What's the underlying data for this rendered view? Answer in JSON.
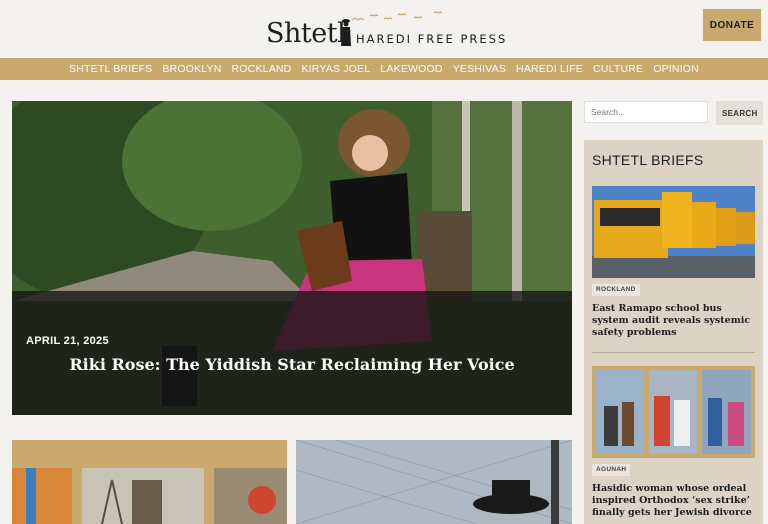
{
  "header": {
    "logo_main": "Shtetl",
    "logo_sub": "HAREDI FREE PRESS",
    "donate_label": "DONATE"
  },
  "nav": {
    "items": [
      "SHTETL BRIEFS",
      "BROOKLYN",
      "ROCKLAND",
      "KIRYAS JOEL",
      "LAKEWOOD",
      "YESHIVAS",
      "HAREDI LIFE",
      "CULTURE",
      "OPINION"
    ]
  },
  "hero": {
    "date": "APRIL 21, 2025",
    "title": "Riki Rose: The Yiddish Star Reclaiming Her Voice"
  },
  "search": {
    "placeholder": "Search...",
    "button_label": "SEARCH"
  },
  "sidebar": {
    "title": "SHTETL BRIEFS",
    "items": [
      {
        "tag": "ROCKLAND",
        "headline": "East Ramapo school bus system audit reveals systemic safety problems"
      },
      {
        "tag": "AGUNAH",
        "headline": "Hasidic woman whose ordeal inspired Orthodox ‘sex strike’ finally gets her Jewish divorce"
      }
    ]
  },
  "colors": {
    "accent": "#c9a96e",
    "background": "#f4f2ee",
    "sidebar_bg": "#dcd3c4"
  }
}
